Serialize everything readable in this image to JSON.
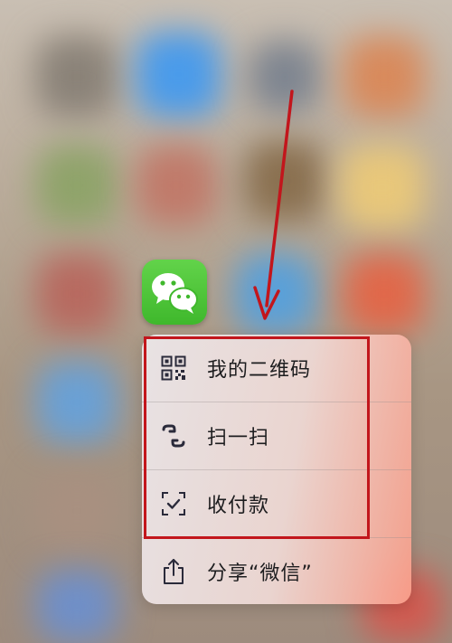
{
  "colors": {
    "wechat_green": "#4fc43a",
    "annotation_red": "#c2161c",
    "menu_text": "#1d1d1f",
    "icon_dark": "#2a2a3a"
  },
  "app": {
    "name_icon": "wechat-app-icon"
  },
  "quick_actions": [
    {
      "icon": "qr-code-icon",
      "label": "我的二维码"
    },
    {
      "icon": "scan-icon",
      "label": "扫一扫"
    },
    {
      "icon": "payment-scan-icon",
      "label": "收付款"
    },
    {
      "icon": "share-icon",
      "label": "分享“微信”"
    }
  ]
}
